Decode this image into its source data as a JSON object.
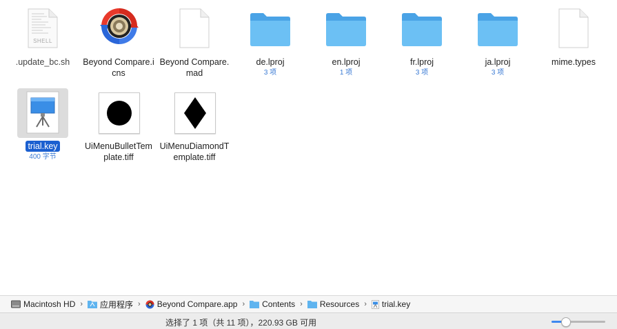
{
  "files": [
    {
      "name": ".update_bc.sh",
      "sub": "",
      "kind": "shell-script",
      "icon_text": "SHELL"
    },
    {
      "name": "Beyond Compare.icns",
      "sub": "",
      "kind": "app-icon"
    },
    {
      "name": "Beyond Compare.mad",
      "sub": "",
      "kind": "document"
    },
    {
      "name": "de.lproj",
      "sub": "3 项",
      "kind": "folder"
    },
    {
      "name": "en.lproj",
      "sub": "1 项",
      "kind": "folder"
    },
    {
      "name": "fr.lproj",
      "sub": "3 项",
      "kind": "folder"
    },
    {
      "name": "ja.lproj",
      "sub": "3 项",
      "kind": "folder"
    },
    {
      "name": "mime.types",
      "sub": "",
      "kind": "document"
    },
    {
      "name": "trial.key",
      "sub": "400 字节",
      "kind": "keynote",
      "selected": true
    },
    {
      "name": "UiMenuBulletTemplate.tiff",
      "sub": "",
      "kind": "tiff-bullet"
    },
    {
      "name": "UiMenuDiamondTemplate.tiff",
      "sub": "",
      "kind": "tiff-diamond"
    }
  ],
  "path_bar": [
    {
      "label": "Macintosh HD",
      "icon": "hard-drive-icon"
    },
    {
      "label": "应用程序",
      "icon": "applications-folder-icon"
    },
    {
      "label": "Beyond Compare.app",
      "icon": "beyond-compare-app-icon"
    },
    {
      "label": "Contents",
      "icon": "folder-icon"
    },
    {
      "label": "Resources",
      "icon": "folder-icon"
    },
    {
      "label": "trial.key",
      "icon": "keynote-file-icon"
    }
  ],
  "path_separator": "›",
  "status": {
    "text": "选择了 1 项（共 11 项），220.93 GB 可用",
    "icon_size_fraction": 0.25
  },
  "colors": {
    "folder": "#5fb4ef",
    "selection": "#1a5fd0",
    "subtext": "#3b7bd4"
  }
}
